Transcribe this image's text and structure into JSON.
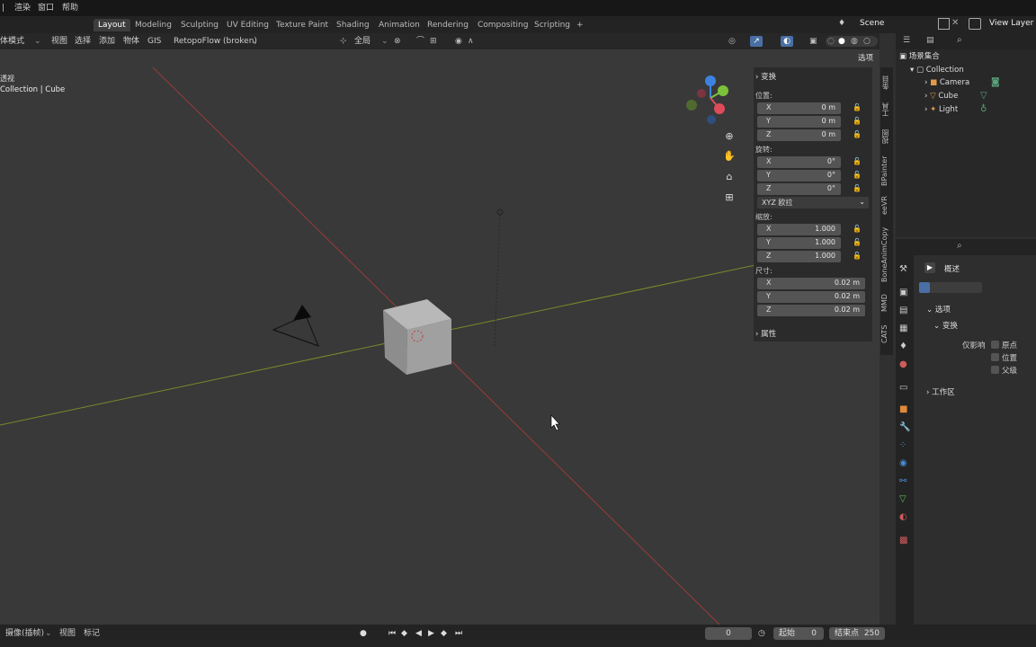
{
  "top_menu": [
    "渲染",
    "窗口",
    "帮助"
  ],
  "workspace_tabs": [
    {
      "label": "Layout",
      "active": true
    },
    {
      "label": "Modeling",
      "active": false
    },
    {
      "label": "Sculpting",
      "active": false
    },
    {
      "label": "UV Editing",
      "active": false
    },
    {
      "label": "Texture Paint",
      "active": false
    },
    {
      "label": "Shading",
      "active": false
    },
    {
      "label": "Animation",
      "active": false
    },
    {
      "label": "Rendering",
      "active": false
    },
    {
      "label": "Compositing",
      "active": false
    },
    {
      "label": "Scripting",
      "active": false
    }
  ],
  "add_tab": "+",
  "scene": {
    "name": "Scene"
  },
  "view_layer": "View Layer",
  "viewport_header": {
    "mode": "体模式",
    "menus": [
      "视图",
      "选择",
      "添加",
      "物体",
      "GIS"
    ],
    "addon": "RetopoFlow (broken)",
    "transform_orientation": "全局",
    "options": "选项"
  },
  "viewport_overlay": {
    "view_name": "透视",
    "collection_info": "Collection | Cube"
  },
  "npanel": {
    "section_transform": "变换",
    "location_label": "位置:",
    "location": [
      {
        "axis": "X",
        "value": "0 m"
      },
      {
        "axis": "Y",
        "value": "0 m"
      },
      {
        "axis": "Z",
        "value": "0 m"
      }
    ],
    "rotation_label": "旋转:",
    "rotation": [
      {
        "axis": "X",
        "value": "0°"
      },
      {
        "axis": "Y",
        "value": "0°"
      },
      {
        "axis": "Z",
        "value": "0°"
      }
    ],
    "rotation_mode": "XYZ 欧拉",
    "scale_label": "缩放:",
    "scale": [
      {
        "axis": "X",
        "value": "1.000"
      },
      {
        "axis": "Y",
        "value": "1.000"
      },
      {
        "axis": "Z",
        "value": "1.000"
      }
    ],
    "dimensions_label": "尺寸:",
    "dimensions": [
      {
        "axis": "X",
        "value": "0.02 m"
      },
      {
        "axis": "Y",
        "value": "0.02 m"
      },
      {
        "axis": "Z",
        "value": "0.02 m"
      }
    ],
    "section_properties": "属性"
  },
  "side_tabs": [
    "条目",
    "工具",
    "视图",
    "BPainter",
    "eeVR",
    "BoneAnimCopy",
    "MMD",
    "CATS"
  ],
  "outliner": {
    "root": "场景集合",
    "collection": "Collection",
    "items": [
      "Camera",
      "Cube",
      "Light"
    ]
  },
  "properties": {
    "title": "概述",
    "options": "选项",
    "transform": "变换",
    "affect_only": "仅影响",
    "checks": [
      "原点",
      "位置",
      "父级"
    ],
    "workspace": "工作区"
  },
  "timeline": {
    "menus": [
      "摄像(插帧)",
      "视图",
      "标记"
    ],
    "current_frame": "0",
    "start_label": "起始",
    "start": "0",
    "end_label": "结束点",
    "end": "250"
  },
  "colors": {
    "x_axis": "#b23a3a",
    "y_axis": "#8a9a2a",
    "gizmo_x": "#e04b5a",
    "gizmo_y": "#7ac23a",
    "gizmo_z": "#3d82e0"
  }
}
